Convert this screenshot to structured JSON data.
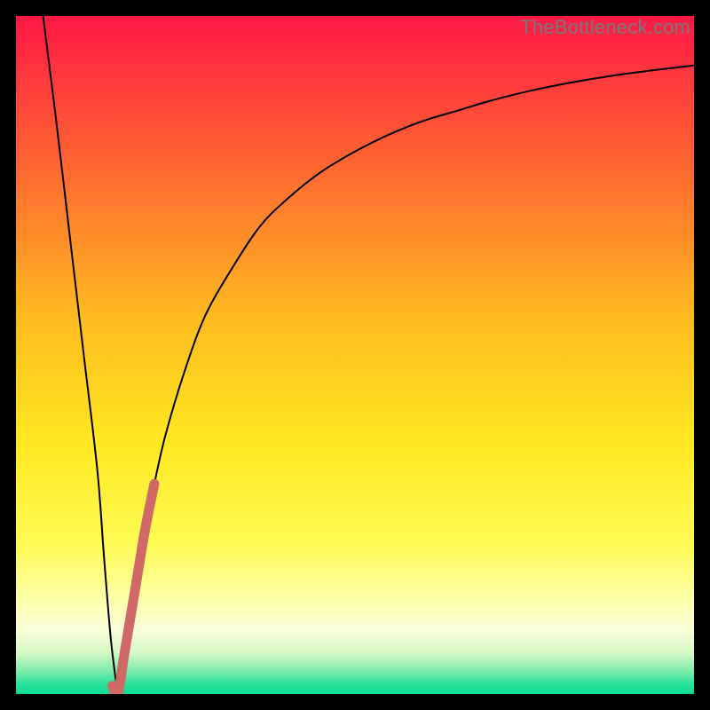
{
  "watermark": "TheBottleneck.com",
  "chart_data": {
    "type": "line",
    "title": "",
    "xlabel": "",
    "ylabel": "",
    "xlim": [
      0,
      100
    ],
    "ylim": [
      0,
      100
    ],
    "grid": false,
    "legend": false,
    "gradient_stops": [
      {
        "offset": 0.0,
        "color": "#ff1846"
      },
      {
        "offset": 0.2,
        "color": "#ff5f33"
      },
      {
        "offset": 0.45,
        "color": "#ffbc20"
      },
      {
        "offset": 0.63,
        "color": "#ffe821"
      },
      {
        "offset": 0.78,
        "color": "#fffb55"
      },
      {
        "offset": 0.86,
        "color": "#fdffa8"
      },
      {
        "offset": 0.905,
        "color": "#fafed8"
      },
      {
        "offset": 0.94,
        "color": "#d4f8c4"
      },
      {
        "offset": 0.965,
        "color": "#82ecac"
      },
      {
        "offset": 0.985,
        "color": "#2ae29a"
      },
      {
        "offset": 1.0,
        "color": "#05dc94"
      }
    ],
    "series": [
      {
        "name": "left-falling-curve",
        "stroke": "#000000",
        "x": [
          4,
          6,
          8,
          10,
          12,
          13,
          14,
          15
        ],
        "values": [
          100,
          84,
          67,
          50,
          33,
          20,
          8,
          0
        ]
      },
      {
        "name": "right-rising-curve",
        "stroke": "#000000",
        "x": [
          15,
          16,
          18,
          20,
          22,
          25,
          28,
          32,
          36,
          40,
          45,
          50,
          55,
          60,
          65,
          70,
          76,
          82,
          88,
          94,
          100
        ],
        "values": [
          0,
          6,
          18,
          29,
          38,
          48,
          56,
          63,
          69,
          73,
          77,
          80,
          82.5,
          84.5,
          86,
          87.5,
          89,
          90.2,
          91.2,
          92,
          92.7
        ]
      },
      {
        "name": "highlight-segment",
        "stroke": "#d06868",
        "x": [
          14.2,
          15,
          16,
          17,
          18,
          19,
          20.4
        ],
        "values": [
          1.2,
          0,
          6,
          12,
          18,
          24,
          31
        ]
      }
    ]
  }
}
